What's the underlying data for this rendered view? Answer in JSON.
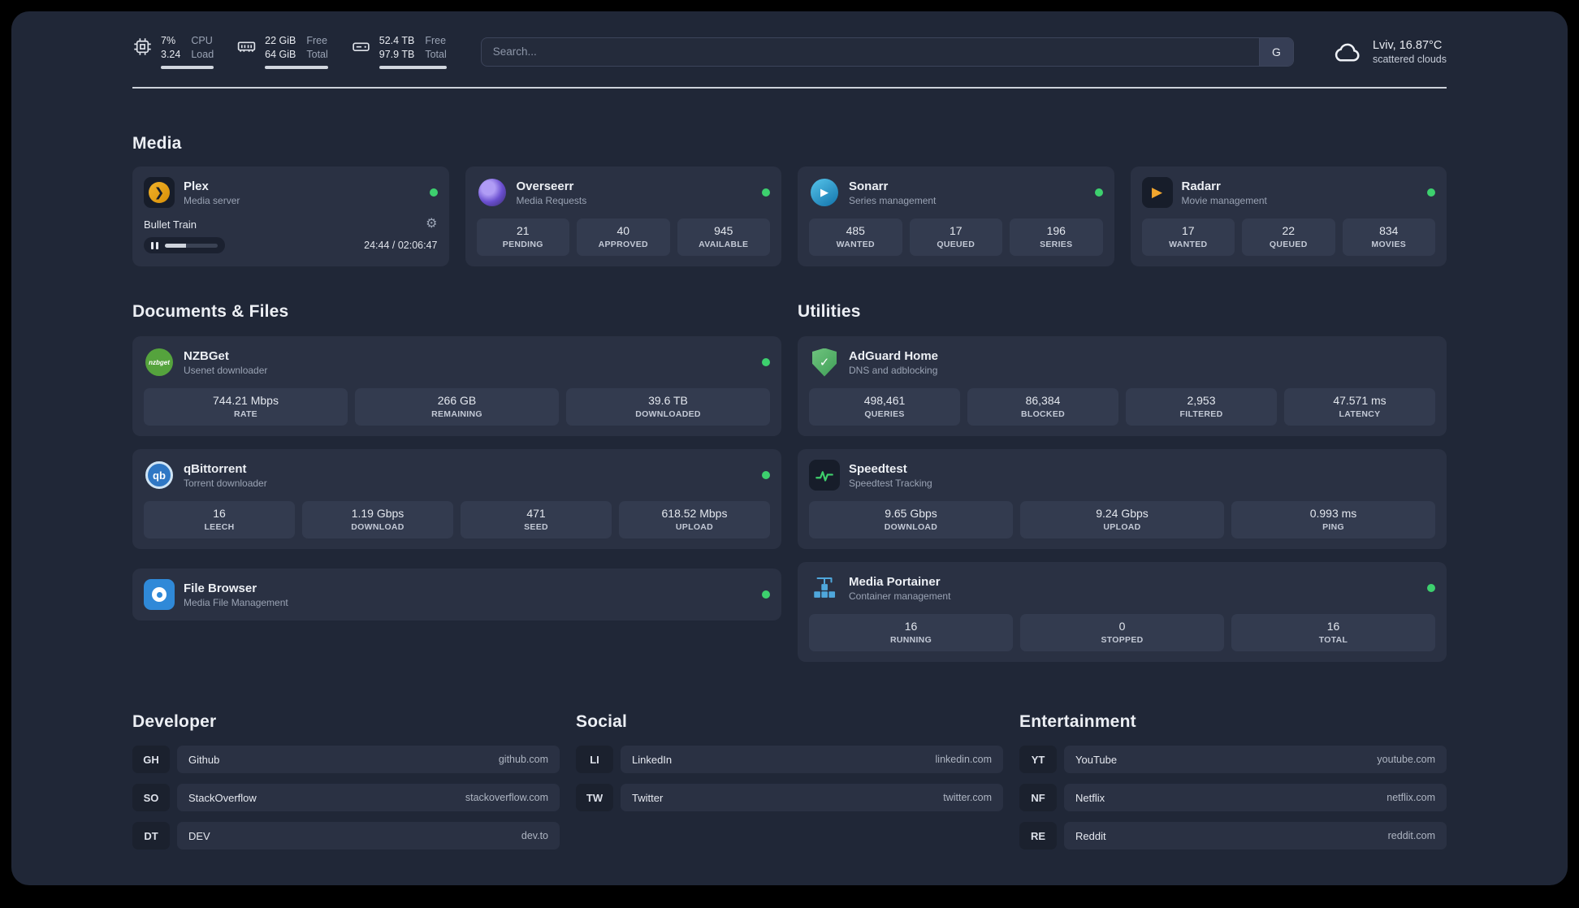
{
  "topbar": {
    "cpu": {
      "value": "7%",
      "load": "3.24",
      "label_top": "CPU",
      "label_bottom": "Load"
    },
    "ram": {
      "free": "22 GiB",
      "total": "64 GiB",
      "label_top": "Free",
      "label_bottom": "Total"
    },
    "disk": {
      "free": "52.4 TB",
      "total": "97.9 TB",
      "label_top": "Free",
      "label_bottom": "Total"
    },
    "search": {
      "placeholder": "Search...",
      "engine_label": "G"
    },
    "weather": {
      "location": "Lviv, 16.87°C",
      "condition": "scattered clouds"
    }
  },
  "media": {
    "title": "Media",
    "plex": {
      "name": "Plex",
      "subtitle": "Media server",
      "now_playing": "Bullet Train",
      "time": "24:44 / 02:06:47"
    },
    "overseerr": {
      "name": "Overseerr",
      "subtitle": "Media Requests",
      "stats": [
        {
          "value": "21",
          "label": "PENDING"
        },
        {
          "value": "40",
          "label": "APPROVED"
        },
        {
          "value": "945",
          "label": "AVAILABLE"
        }
      ]
    },
    "sonarr": {
      "name": "Sonarr",
      "subtitle": "Series management",
      "stats": [
        {
          "value": "485",
          "label": "WANTED"
        },
        {
          "value": "17",
          "label": "QUEUED"
        },
        {
          "value": "196",
          "label": "SERIES"
        }
      ]
    },
    "radarr": {
      "name": "Radarr",
      "subtitle": "Movie management",
      "stats": [
        {
          "value": "17",
          "label": "WANTED"
        },
        {
          "value": "22",
          "label": "QUEUED"
        },
        {
          "value": "834",
          "label": "MOVIES"
        }
      ]
    }
  },
  "documents": {
    "title": "Documents & Files",
    "nzbget": {
      "name": "NZBGet",
      "subtitle": "Usenet downloader",
      "icon_text": "nzbget",
      "stats": [
        {
          "value": "744.21 Mbps",
          "label": "RATE"
        },
        {
          "value": "266 GB",
          "label": "REMAINING"
        },
        {
          "value": "39.6 TB",
          "label": "DOWNLOADED"
        }
      ]
    },
    "qbittorrent": {
      "name": "qBittorrent",
      "subtitle": "Torrent downloader",
      "icon_text": "qb",
      "stats": [
        {
          "value": "16",
          "label": "LEECH"
        },
        {
          "value": "1.19 Gbps",
          "label": "DOWNLOAD"
        },
        {
          "value": "471",
          "label": "SEED"
        },
        {
          "value": "618.52 Mbps",
          "label": "UPLOAD"
        }
      ]
    },
    "filebrowser": {
      "name": "File Browser",
      "subtitle": "Media File Management"
    }
  },
  "utilities": {
    "title": "Utilities",
    "adguard": {
      "name": "AdGuard Home",
      "subtitle": "DNS and adblocking",
      "stats": [
        {
          "value": "498,461",
          "label": "QUERIES"
        },
        {
          "value": "86,384",
          "label": "BLOCKED"
        },
        {
          "value": "2,953",
          "label": "FILTERED"
        },
        {
          "value": "47.571 ms",
          "label": "LATENCY"
        }
      ]
    },
    "speedtest": {
      "name": "Speedtest",
      "subtitle": "Speedtest Tracking",
      "stats": [
        {
          "value": "9.65 Gbps",
          "label": "DOWNLOAD"
        },
        {
          "value": "9.24 Gbps",
          "label": "UPLOAD"
        },
        {
          "value": "0.993 ms",
          "label": "PING"
        }
      ]
    },
    "portainer": {
      "name": "Media Portainer",
      "subtitle": "Container management",
      "stats": [
        {
          "value": "16",
          "label": "RUNNING"
        },
        {
          "value": "0",
          "label": "STOPPED"
        },
        {
          "value": "16",
          "label": "TOTAL"
        }
      ]
    }
  },
  "link_groups": [
    {
      "title": "Developer",
      "items": [
        {
          "abbr": "GH",
          "name": "Github",
          "url": "github.com"
        },
        {
          "abbr": "SO",
          "name": "StackOverflow",
          "url": "stackoverflow.com"
        },
        {
          "abbr": "DT",
          "name": "DEV",
          "url": "dev.to"
        }
      ]
    },
    {
      "title": "Social",
      "items": [
        {
          "abbr": "LI",
          "name": "LinkedIn",
          "url": "linkedin.com"
        },
        {
          "abbr": "TW",
          "name": "Twitter",
          "url": "twitter.com"
        }
      ]
    },
    {
      "title": "Entertainment",
      "items": [
        {
          "abbr": "YT",
          "name": "YouTube",
          "url": "youtube.com"
        },
        {
          "abbr": "NF",
          "name": "Netflix",
          "url": "netflix.com"
        },
        {
          "abbr": "RE",
          "name": "Reddit",
          "url": "reddit.com"
        }
      ]
    }
  ],
  "colors": {
    "status_online": "#3dd06e",
    "plex_amber": "#e5a00d",
    "overseerr_purple": "#6a4fd0",
    "sonarr_blue": "#35a7d8",
    "adguard_green": "#5aad63"
  }
}
